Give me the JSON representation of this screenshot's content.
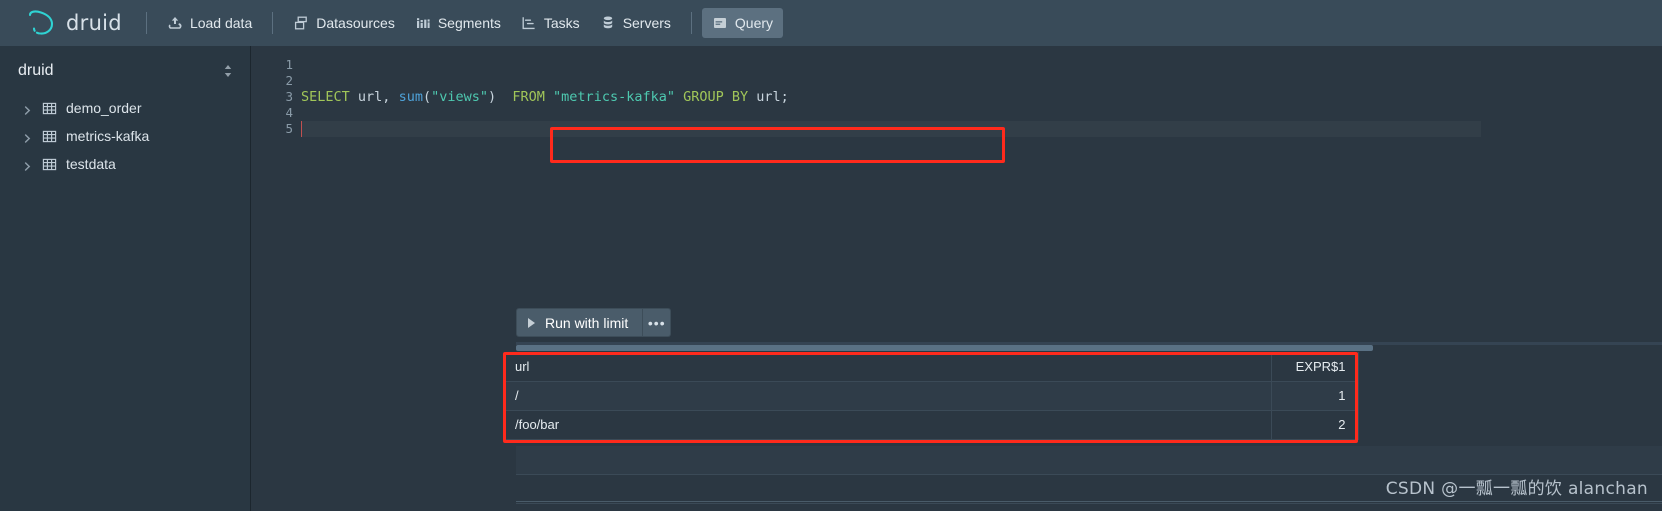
{
  "navbar": {
    "brand": "druid",
    "items": [
      {
        "label": "Load data",
        "icon": "upload-cloud-icon",
        "active": false
      },
      {
        "label": "Datasources",
        "icon": "multi-select-icon",
        "active": false
      },
      {
        "label": "Segments",
        "icon": "stacked-chart-icon",
        "active": false
      },
      {
        "label": "Tasks",
        "icon": "gantt-chart-icon",
        "active": false
      },
      {
        "label": "Servers",
        "icon": "database-icon",
        "active": false
      },
      {
        "label": "Query",
        "icon": "application-icon",
        "active": true
      }
    ]
  },
  "sidebar": {
    "schema": "druid",
    "schema_toggle_icon": "double-caret-vertical-icon",
    "tables": [
      {
        "label": "demo_order",
        "icon": "table-icon",
        "caret": "chevron-right-icon"
      },
      {
        "label": "metrics-kafka",
        "icon": "table-icon",
        "caret": "chevron-right-icon"
      },
      {
        "label": "testdata",
        "icon": "table-icon",
        "caret": "chevron-right-icon"
      }
    ]
  },
  "editor": {
    "line_numbers": [
      "1",
      "2",
      "3",
      "4",
      "5"
    ],
    "query_text": "SELECT url, sum(\"views\")  FROM \"metrics-kafka\" GROUP BY url;",
    "tokens": {
      "select": "SELECT",
      "url_ident": " url, ",
      "sum_fn": "sum",
      "open_paren": "(",
      "views_str": "\"views\"",
      "close_paren": ")",
      "gap": "  ",
      "from": "FROM",
      "table_str": " \"metrics-kafka\" ",
      "group_by": "GROUP BY",
      "tail": " url;"
    }
  },
  "toolbar": {
    "run_label": "Run with limit",
    "run_icon": "play-icon",
    "more_label": "•••",
    "more_icon": "more-options-icon"
  },
  "results": {
    "columns": [
      "url",
      "EXPR$1"
    ],
    "rows": [
      {
        "url": "/",
        "expr1": "1"
      },
      {
        "url": "/foo/bar",
        "expr1": "2"
      }
    ]
  },
  "annotations": {
    "highlight_color": "#ff2a1c",
    "query_box_label": "sql-statement-highlight",
    "results_box_label": "results-table-highlight"
  },
  "watermark": "CSDN @一瓢一瓢的饮 alanchan",
  "colors": {
    "navbar_bg": "#394b59",
    "page_bg": "#2b3742",
    "sidebar_bg": "#293742",
    "accent_cyan": "#2fd3d3",
    "keyword_green": "#a1c659",
    "string_teal": "#4ec9b0",
    "function_blue": "#4ea2d9"
  }
}
